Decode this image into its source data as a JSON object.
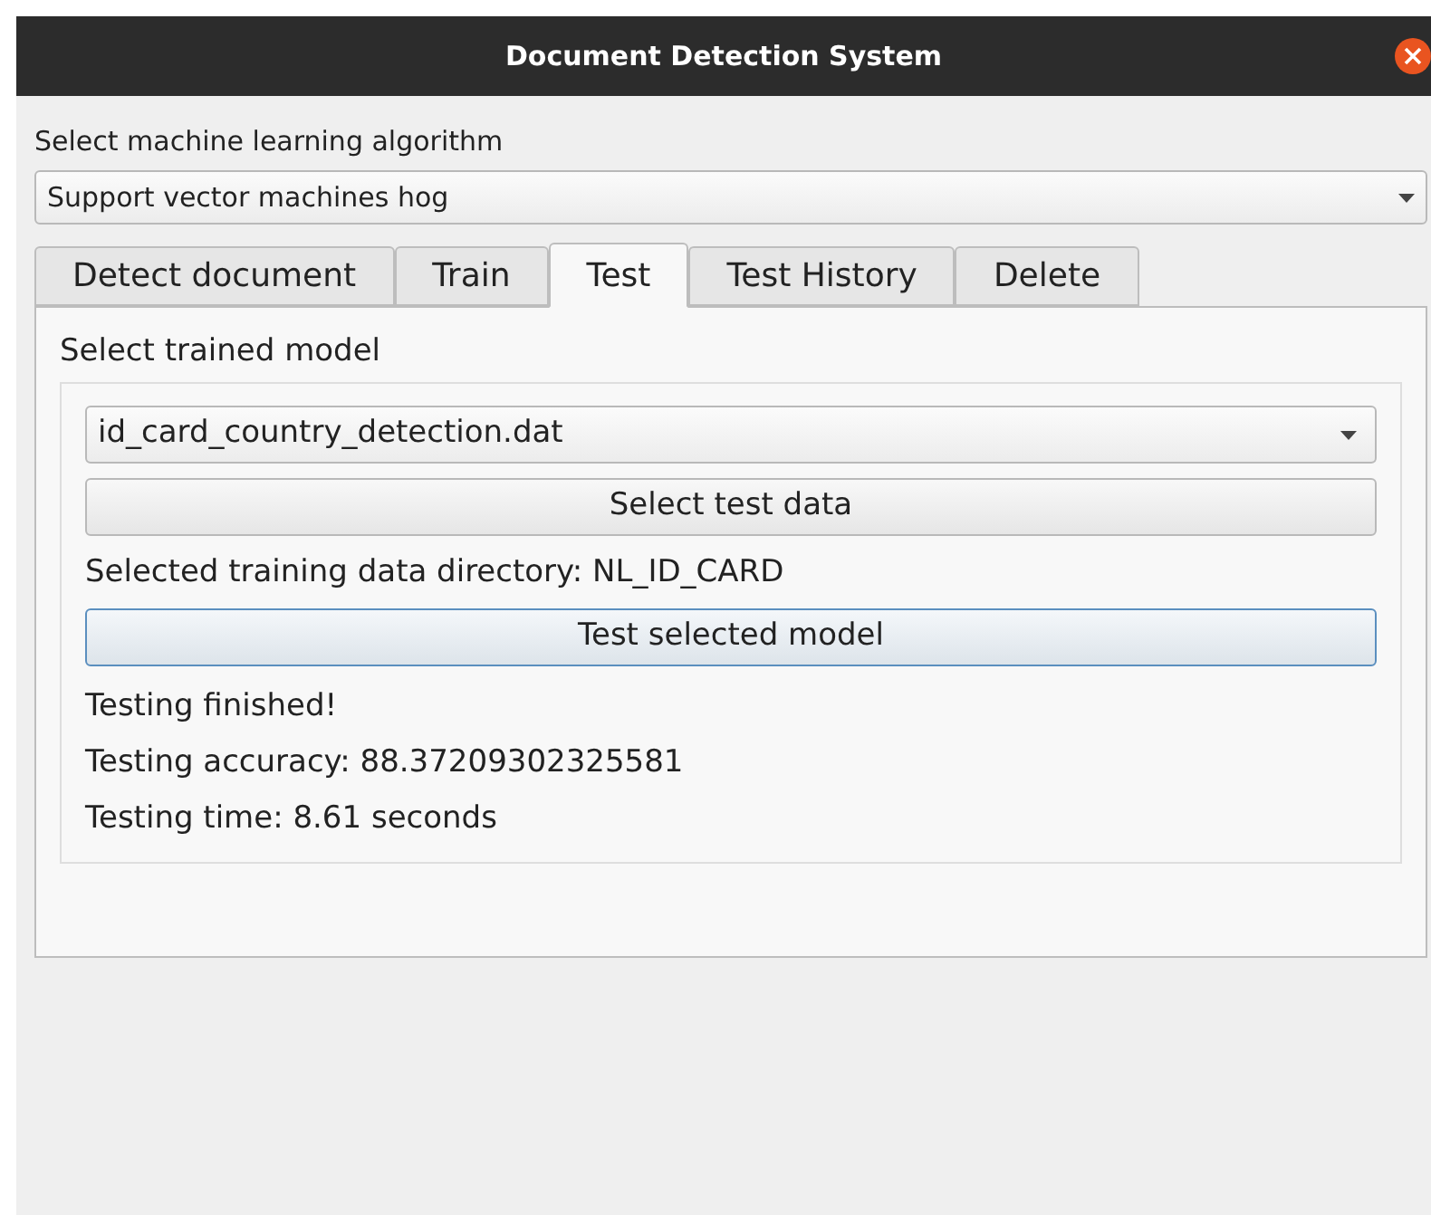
{
  "window": {
    "title": "Document Detection System"
  },
  "algorithm_label": "Select machine learning algorithm",
  "algorithm_select": {
    "value": "Support vector machines hog"
  },
  "tabs": [
    {
      "label": "Detect document",
      "selected": false
    },
    {
      "label": "Train",
      "selected": false
    },
    {
      "label": "Test",
      "selected": true
    },
    {
      "label": "Test History",
      "selected": false
    },
    {
      "label": "Delete",
      "selected": false
    }
  ],
  "test_panel": {
    "model_label": "Select trained model",
    "model_select": {
      "value": "id_card_country_detection.dat"
    },
    "select_data_button": {
      "label": "Select test data",
      "focused": false
    },
    "directory_text": "Selected training data directory: NL_ID_CARD",
    "test_button": {
      "label": "Test selected model",
      "focused": true
    },
    "results": [
      "Testing finished!",
      "Testing accuracy: 88.37209302325581",
      "Testing time: 8.61 seconds"
    ]
  }
}
